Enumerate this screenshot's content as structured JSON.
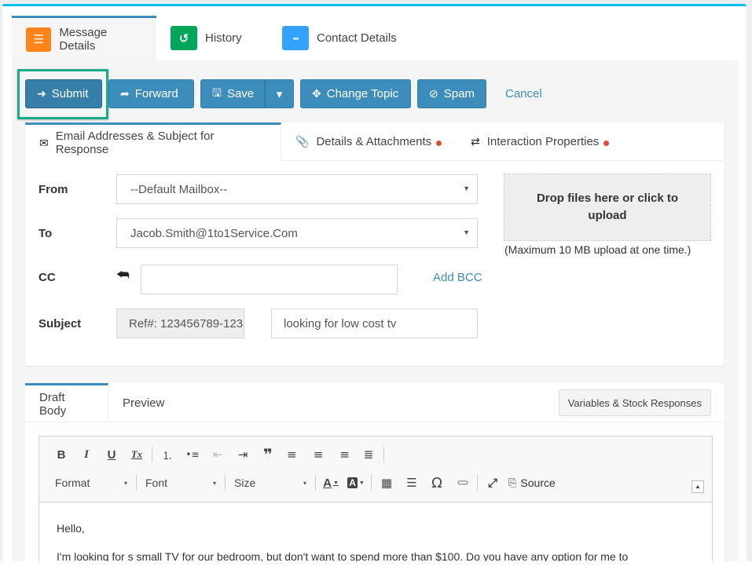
{
  "colors": {
    "primary": "#3c8dbc",
    "top_border": "#00c0ef",
    "tab_message_details": "#ff851b",
    "tab_history": "#00a65a",
    "tab_contact_details": "#33a3ff",
    "highlight": "#1aaa8a",
    "required_dot": "#dd4b39"
  },
  "top_tabs": [
    {
      "label": "Message Details",
      "icon": "list-icon",
      "glyph": "☰",
      "active": true
    },
    {
      "label": "History",
      "icon": "history-icon",
      "glyph": "↺",
      "active": false
    },
    {
      "label": "Contact Details",
      "icon": "ellipsis-icon",
      "glyph": "•••",
      "active": false
    }
  ],
  "actions": {
    "submit": {
      "label": "Submit",
      "glyph": "➜"
    },
    "forward": {
      "label": "Forward",
      "glyph": "➦"
    },
    "save": {
      "label": "Save",
      "glyph": "🖫",
      "caret": "▾"
    },
    "change_topic": {
      "label": "Change Topic",
      "glyph": "✥"
    },
    "spam": {
      "label": "Spam",
      "glyph": "⊘"
    },
    "cancel": {
      "label": "Cancel"
    }
  },
  "email_tabs": [
    {
      "label": "Email Addresses & Subject for Response",
      "glyph": "✉",
      "active": true,
      "required": false
    },
    {
      "label": "Details & Attachments",
      "glyph": "📎",
      "active": false,
      "required": true
    },
    {
      "label": "Interaction Properties",
      "glyph": "⇄",
      "active": false,
      "required": true
    }
  ],
  "form": {
    "from": {
      "label": "From",
      "value": "--Default Mailbox--"
    },
    "to": {
      "label": "To",
      "value": "Jacob.Smith@1to1Service.Com"
    },
    "cc": {
      "label": "CC",
      "value": "",
      "add_bcc": "Add BCC"
    },
    "subject": {
      "label": "Subject",
      "ref": "Ref#: 123456789-123",
      "value": "looking for low cost tv"
    },
    "select_arrow": "▼",
    "reply_all_glyph": "«"
  },
  "upload": {
    "dropzone": "Drop files here or click to upload",
    "note": "(Maximum 10 MB upload at one time.)"
  },
  "draft": {
    "tabs": [
      {
        "label": "Draft Body",
        "active": true
      },
      {
        "label": "Preview",
        "active": false
      }
    ],
    "variables_button": "Variables & Stock Responses",
    "toolbar": {
      "bold": "B",
      "italic": "I",
      "underline": "U",
      "remove_format": "Tx",
      "numbered_list": "⒈",
      "bulleted_list": "•≡",
      "outdent": "⇤",
      "indent": "⇥",
      "blockquote": "❞",
      "align_left": "≡",
      "align_center": "≡",
      "align_right": "≡",
      "justify": "≣",
      "format": "Format",
      "font": "Font",
      "size": "Size",
      "text_color": "A",
      "bg_color": "A",
      "table": "▦",
      "hr": "☰",
      "special_char": "Ω",
      "link": "⊂⊃",
      "maximize": "⤢",
      "source": "Source",
      "source_glyph": "⎘",
      "combo_arrow": "▾",
      "collapse": "▲"
    },
    "body": [
      "Hello,",
      "I'm looking for s small TV for our bedroom, but don't want to spend more than $100. Do you have any option for me to"
    ]
  }
}
